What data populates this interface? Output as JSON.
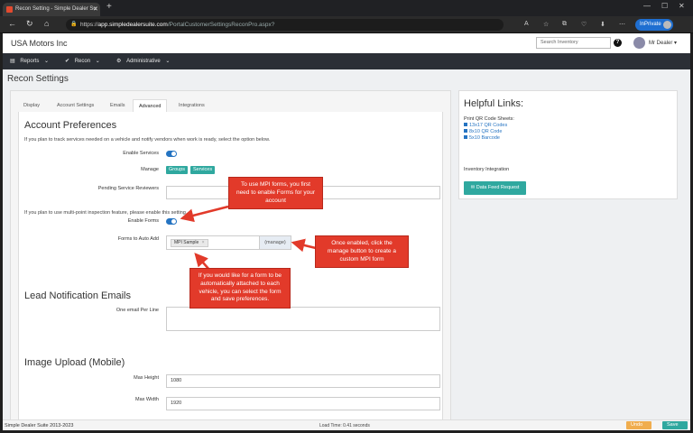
{
  "browser": {
    "tab_title": "Recon Setting - Simple Dealer Su",
    "tab_close": "✕",
    "new_tab": "+",
    "url_lock": "🔒",
    "url_prefix": "https://",
    "url_host": "app.simpledealersuite.com",
    "url_path": "/PortalCustomerSettingsReconPro.aspx?",
    "inprivate_label": "InPrivate",
    "win_minimize": "—",
    "win_maximize": "☐",
    "win_close": "✕",
    "nav_back": "←",
    "nav_refresh": "↻",
    "nav_home": "⌂",
    "tb_icons": [
      "A",
      "☆",
      "⧉",
      "♡",
      "⬇",
      "⋯"
    ]
  },
  "app": {
    "brand": "USA Motors Inc",
    "search_placeholder": "Search Inventory",
    "help_icon": "?",
    "user_name": "Mr Dealer ▾",
    "nav": [
      {
        "icon": "▤",
        "label": "Reports",
        "caret": "⌄"
      },
      {
        "icon": "✔",
        "label": "Recon",
        "caret": "⌄"
      },
      {
        "icon": "⚙",
        "label": "Administrative",
        "caret": "⌄"
      }
    ],
    "page_title": "Recon Settings"
  },
  "settings": {
    "tabs": [
      "Display",
      "Account Settings",
      "Emails",
      "Advanced",
      "Integrations"
    ],
    "active_tab": "Advanced",
    "account_prefs": {
      "heading": "Account Preferences",
      "services_note": "If you plan to track services needed on a vehicle and notify vendors when work is ready, select the option below.",
      "enable_services_label": "Enable Services",
      "manage_label": "Manage",
      "chip_groups": "Groups",
      "chip_services": "Services",
      "pending_reviewers_label": "Pending Service Reviewers",
      "mpi_note": "If you plan to use multi-point inspection feature, please enable this setting.",
      "enable_forms_label": "Enable Forms",
      "forms_auto_add_label": "Forms to Auto Add",
      "form_tag": "MPI Sample",
      "form_tag_remove": "×",
      "manage_button": "(manage)"
    },
    "lead_notifications": {
      "heading": "Lead Notification Emails",
      "email_label": "One email Per Line"
    },
    "image_upload": {
      "heading": "Image Upload (Mobile)",
      "max_height_label": "Max Height",
      "max_height_value": "1080",
      "max_width_label": "Max Width",
      "max_width_value": "1920"
    }
  },
  "helpful_links": {
    "title": "Helpful Links:",
    "qr_heading": "Print QR Code Sheets:",
    "links": [
      "13x17 QR Codes",
      "8x10 QR Code",
      "5x10 Barcode"
    ],
    "integration_label": "Inventory Integration",
    "datafeed_button": "Data Feed Request"
  },
  "footer": {
    "copyright": "Simple Dealer Suite 2013-2023",
    "load_time": "Load Time: 0.41 seconds",
    "undo": "Undo",
    "save": "Save"
  },
  "callouts": {
    "enable_forms": "To use MPI forms, you first need to enable Forms for your account",
    "manage": "Once enabled, click the manage button to create a custom MPI form",
    "auto_add": "If you would like for a form to be automatically attached to each vehicle, you can select the form and save preferences."
  },
  "colors": {
    "accent_teal": "#2fa89f",
    "toggle_blue": "#2574c2",
    "callout_red": "#e23a2a",
    "nav_dark": "#2b2f36",
    "undo_orange": "#f0ad4e"
  }
}
